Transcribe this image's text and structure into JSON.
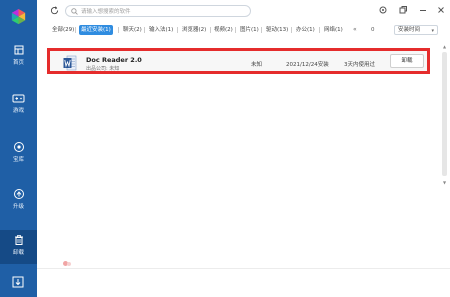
{
  "sidebar": {
    "items": [
      {
        "label": "首页",
        "icon": "home-icon"
      },
      {
        "label": "游戏",
        "icon": "gamepad-icon"
      },
      {
        "label": "宝库",
        "icon": "store-icon"
      },
      {
        "label": "升级",
        "icon": "upgrade-icon"
      },
      {
        "label": "卸载",
        "icon": "trash-icon"
      }
    ],
    "active_index": 4,
    "background_color": "#1f5fa6",
    "active_color": "#154a86"
  },
  "search": {
    "placeholder": "请输入想搜索的软件"
  },
  "window_controls": [
    "settings-icon",
    "restore-icon",
    "minimize-icon",
    "close-icon"
  ],
  "filters": {
    "tabs": [
      {
        "label": "全部(29)"
      },
      {
        "label": "最近安装(1)"
      },
      {
        "label": "聊天(2)"
      },
      {
        "label": "输入法(1)"
      },
      {
        "label": "浏览器(2)"
      },
      {
        "label": "视频(2)"
      },
      {
        "label": "图片(1)"
      },
      {
        "label": "驱动(13)"
      },
      {
        "label": "办公(1)"
      },
      {
        "label": "网络(1)"
      }
    ],
    "active_index": 1,
    "more": "«",
    "count": "0",
    "sort_label": "安装时间",
    "accent_color": "#2f8ce0"
  },
  "apps": [
    {
      "name": "Doc Reader 2.0",
      "publisher": "出品公司: 未知",
      "size": "未知",
      "install_date": "2021/12/24安装",
      "usage": "3天内使用过",
      "action_label": "卸载",
      "highlight_color": "#e52c2c"
    }
  ]
}
